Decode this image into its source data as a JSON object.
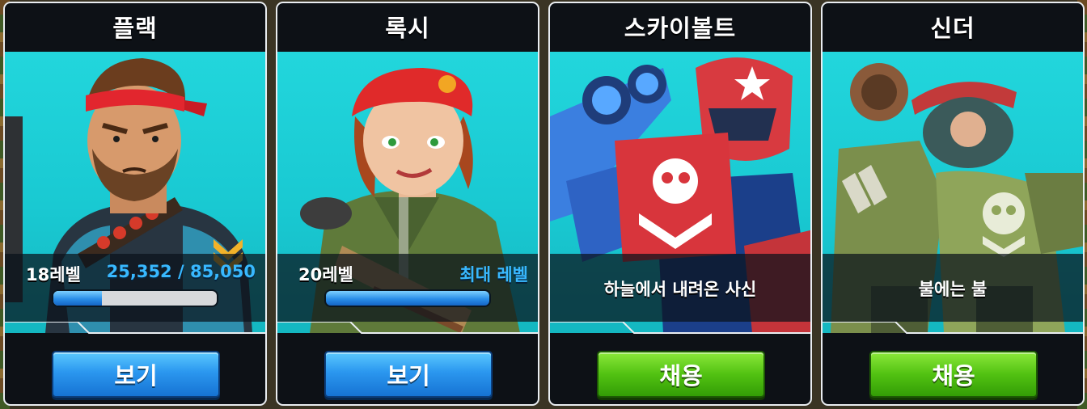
{
  "colors": {
    "card_bg": "#0d1116",
    "portrait_bg": "#1fcfd6",
    "xp_text": "#38b8ff",
    "button_blue": "#2b97ef",
    "button_green": "#52c212"
  },
  "cards": [
    {
      "name": "플랙",
      "level": "18레벨",
      "progress_text": "25,352 / 85,050",
      "progress_fraction": 0.298,
      "button_label": "보기",
      "button_style": "blue"
    },
    {
      "name": "록시",
      "level": "20레벨",
      "progress_text": "최대 레벨",
      "progress_fraction": 1.0,
      "button_label": "보기",
      "button_style": "blue"
    },
    {
      "name": "스카이볼트",
      "tagline": "하늘에서 내려온 사신",
      "button_label": "채용",
      "button_style": "green"
    },
    {
      "name": "신더",
      "tagline": "불에는 불",
      "button_label": "채용",
      "button_style": "green"
    }
  ]
}
